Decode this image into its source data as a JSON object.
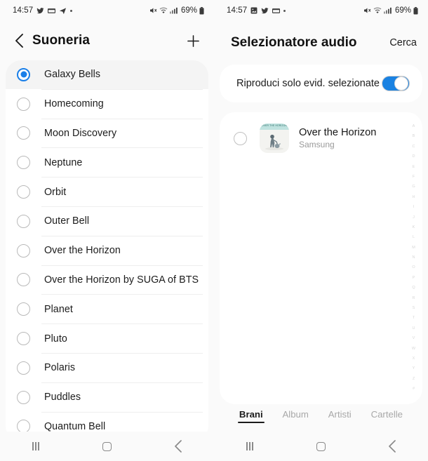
{
  "left": {
    "status": {
      "time": "14:57",
      "icons": [
        "twitter-icon",
        "mail-icon",
        "telegram-icon",
        "dot-icon"
      ],
      "right_icons": [
        "mute-icon",
        "wifi-icon",
        "signal-icon"
      ],
      "battery": "69%"
    },
    "header": {
      "back": "back-chevron",
      "title": "Suoneria",
      "add": "+"
    },
    "ringtones": [
      {
        "label": "Galaxy Bells",
        "selected": true
      },
      {
        "label": "Homecoming",
        "selected": false
      },
      {
        "label": "Moon Discovery",
        "selected": false
      },
      {
        "label": "Neptune",
        "selected": false
      },
      {
        "label": "Orbit",
        "selected": false
      },
      {
        "label": "Outer Bell",
        "selected": false
      },
      {
        "label": "Over the Horizon",
        "selected": false
      },
      {
        "label": "Over the Horizon by SUGA of BTS",
        "selected": false
      },
      {
        "label": "Planet",
        "selected": false
      },
      {
        "label": "Pluto",
        "selected": false
      },
      {
        "label": "Polaris",
        "selected": false
      },
      {
        "label": "Puddles",
        "selected": false
      },
      {
        "label": "Quantum Bell",
        "selected": false
      }
    ],
    "nav": {
      "recents": "recents-icon",
      "home": "home-icon",
      "back": "back-icon"
    }
  },
  "right": {
    "status": {
      "time": "14:57",
      "icons": [
        "gallery-icon",
        "twitter-icon",
        "mail-icon",
        "dot-icon"
      ],
      "right_icons": [
        "mute-icon",
        "wifi-icon",
        "signal-icon"
      ],
      "battery": "69%"
    },
    "header": {
      "title": "Selezionatore audio",
      "action": "Cerca"
    },
    "toggle": {
      "label": "Riproduci solo evid. selezionate",
      "on": true
    },
    "songs": [
      {
        "title": "Over the Horizon",
        "artist": "Samsung",
        "selected": false,
        "art_caption": "OVER THE HORIZON"
      }
    ],
    "index_letters": [
      "A",
      "B",
      "C",
      "D",
      "E",
      "F",
      "G",
      "H",
      "I",
      "J",
      "K",
      "L",
      "M",
      "N",
      "O",
      "P",
      "Q",
      "R",
      "S",
      "T",
      "U",
      "V",
      "W",
      "X",
      "Y",
      "Z",
      "#"
    ],
    "tabs": [
      {
        "label": "Brani",
        "active": true
      },
      {
        "label": "Album",
        "active": false
      },
      {
        "label": "Artisti",
        "active": false
      },
      {
        "label": "Cartelle",
        "active": false
      }
    ],
    "nav": {
      "recents": "recents-icon",
      "home": "home-icon",
      "back": "back-icon"
    }
  },
  "colors": {
    "accent": "#1a7fe8",
    "toggle_on": "#1a82e2",
    "card": "#ffffff",
    "page_bg": "#fafafa",
    "text_primary": "#1c1c1c",
    "text_secondary": "#9a9a9a"
  }
}
